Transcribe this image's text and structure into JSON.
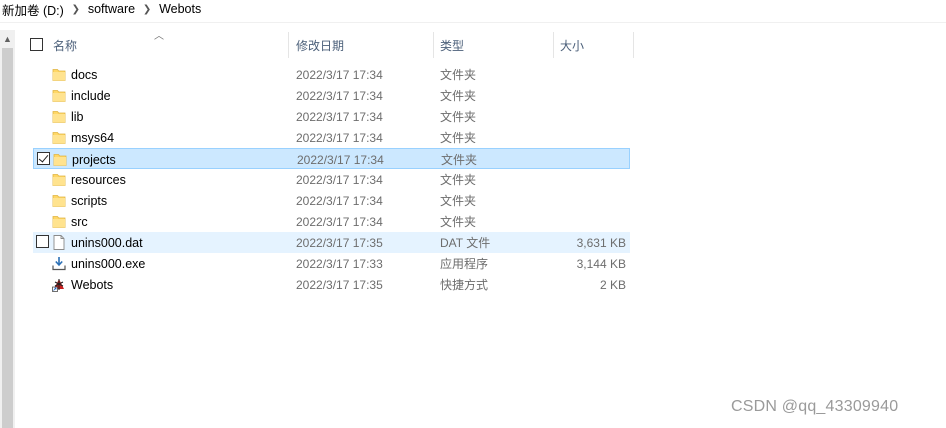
{
  "breadcrumb": {
    "items": [
      "新加卷 (D:)",
      "software",
      "Webots"
    ]
  },
  "columns": {
    "name": "名称",
    "date": "修改日期",
    "type": "类型",
    "size": "大小"
  },
  "files": [
    {
      "name": "docs",
      "date": "2022/3/17 17:34",
      "type": "文件夹",
      "size": "",
      "icon": "folder-icon",
      "state": ""
    },
    {
      "name": "include",
      "date": "2022/3/17 17:34",
      "type": "文件夹",
      "size": "",
      "icon": "folder-icon",
      "state": ""
    },
    {
      "name": "lib",
      "date": "2022/3/17 17:34",
      "type": "文件夹",
      "size": "",
      "icon": "folder-icon",
      "state": ""
    },
    {
      "name": "msys64",
      "date": "2022/3/17 17:34",
      "type": "文件夹",
      "size": "",
      "icon": "folder-icon",
      "state": ""
    },
    {
      "name": "projects",
      "date": "2022/3/17 17:34",
      "type": "文件夹",
      "size": "",
      "icon": "folder-icon",
      "state": "selected"
    },
    {
      "name": "resources",
      "date": "2022/3/17 17:34",
      "type": "文件夹",
      "size": "",
      "icon": "folder-icon",
      "state": ""
    },
    {
      "name": "scripts",
      "date": "2022/3/17 17:34",
      "type": "文件夹",
      "size": "",
      "icon": "folder-icon",
      "state": ""
    },
    {
      "name": "src",
      "date": "2022/3/17 17:34",
      "type": "文件夹",
      "size": "",
      "icon": "folder-icon",
      "state": ""
    },
    {
      "name": "unins000.dat",
      "date": "2022/3/17 17:35",
      "type": "DAT 文件",
      "size": "3,631 KB",
      "icon": "file-icon",
      "state": "hover"
    },
    {
      "name": "unins000.exe",
      "date": "2022/3/17 17:33",
      "type": "应用程序",
      "size": "3,144 KB",
      "icon": "installer-icon",
      "state": ""
    },
    {
      "name": "Webots",
      "date": "2022/3/17 17:35",
      "type": "快捷方式",
      "size": "2 KB",
      "icon": "webots-shortcut-icon",
      "state": ""
    }
  ],
  "watermark": "CSDN @qq_43309940",
  "colors": {
    "selected_bg": "#cce8ff",
    "selected_border": "#99d1ff",
    "hover_bg": "#e5f3ff",
    "folder": "#ffd766",
    "header_text": "#4c607a"
  }
}
